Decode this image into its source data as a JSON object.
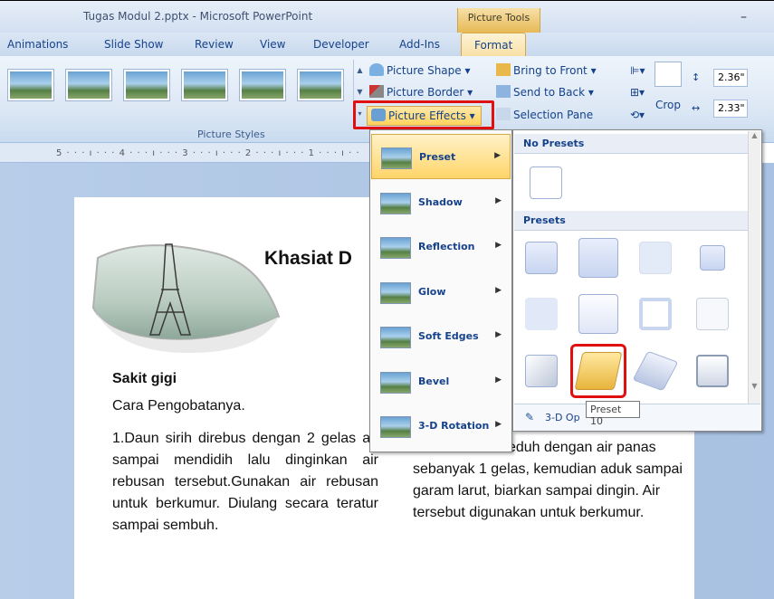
{
  "window": {
    "title": "Tugas Modul 2.pptx - Microsoft PowerPoint",
    "context_tab": "Picture Tools",
    "minimize": "–"
  },
  "tabs": [
    "Animations",
    "Slide Show",
    "Review",
    "View",
    "Developer",
    "Add-Ins",
    "Format"
  ],
  "active_tab": "Format",
  "ribbon": {
    "picture_styles_label": "Picture Styles",
    "picture_shape": "Picture Shape ▾",
    "picture_border": "Picture Border ▾",
    "picture_effects": "Picture Effects ▾",
    "bring_to_front": "Bring to Front ▾",
    "send_to_back": "Send to Back ▾",
    "selection_pane": "Selection Pane",
    "crop": "Crop",
    "height_value": "2.36\"",
    "width_value": "2.33\""
  },
  "ruler_text": "5 · · · ı · · · 4 · · · ı · · · 3 · · · ı · · · 2 · · · ı · · · 1 · · · ı · ·",
  "menu": {
    "items": [
      "Preset",
      "Shadow",
      "Reflection",
      "Glow",
      "Soft Edges",
      "Bevel",
      "3-D Rotation"
    ],
    "highlighted": "Preset",
    "arrow": "▶"
  },
  "submenu": {
    "no_presets": "No Presets",
    "presets": "Presets",
    "footer": "3-D Op",
    "tooltip": "Preset 10",
    "selected_preset_index": 10
  },
  "slide": {
    "title": "Khasiat D",
    "heading": "Sakit gigi",
    "subheading": "Cara Pengobatanya.",
    "list_item": "1.Daun sirih direbus dengan 2 gelas air sampai mendidih lalu dinginkan air rebusan tersebut.Gunakan air rebusan untuk berkumur. Diulang secara teratur sampai sembuh.",
    "right_text": "an tersebut diseduh dengan air panas sebanyak 1 gelas, kemudian aduk sampai garam larut, biarkan sampai dingin. Air tersebut digunakan untuk berkumur."
  },
  "colors": {
    "accent_red": "#e01010",
    "ribbon_text": "#15428b",
    "highlight": "#ffd569"
  }
}
